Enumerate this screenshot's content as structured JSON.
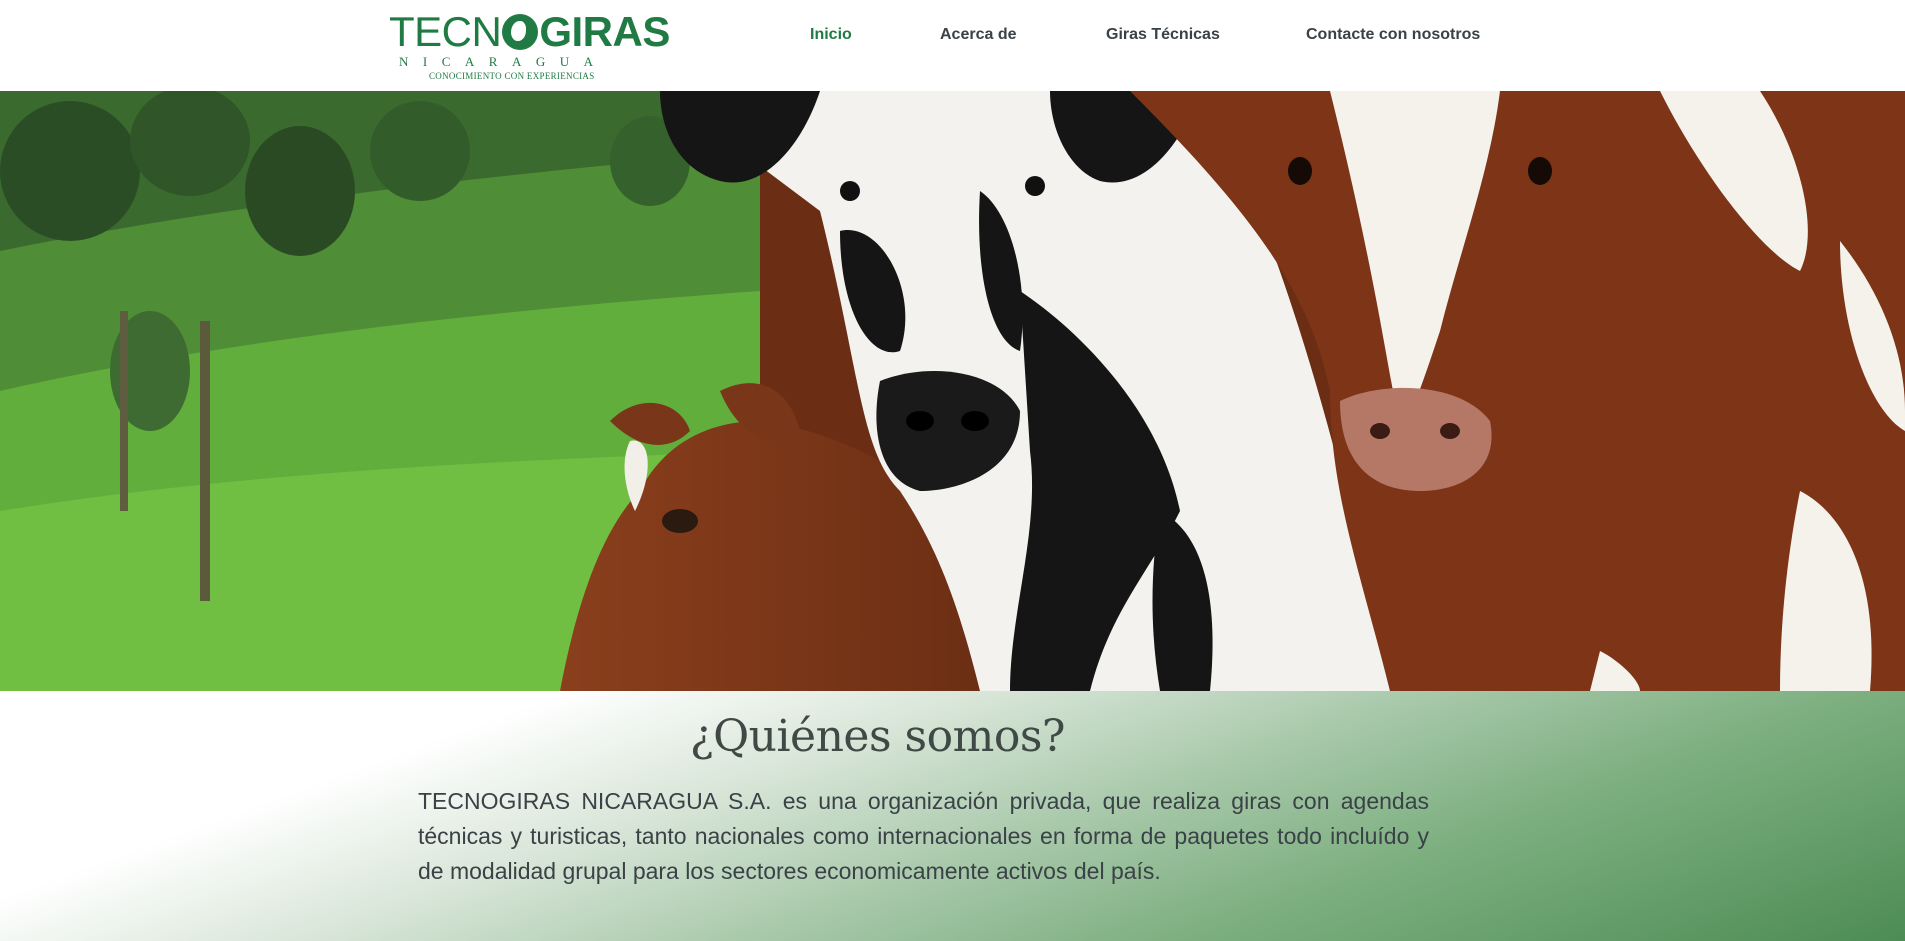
{
  "header": {
    "logo": {
      "word_left": "TECN",
      "word_right": "GIRAS",
      "subtitle": "NICARAGUA",
      "tagline": "CONOCIMIENTO CON EXPERIENCIAS"
    },
    "nav": {
      "items": [
        {
          "label": "Inicio",
          "active": true
        },
        {
          "label": "Acerca de",
          "active": false
        },
        {
          "label": "Giras Técnicas",
          "active": false
        },
        {
          "label": "Contacte con nosotros",
          "active": false
        }
      ]
    }
  },
  "hero": {
    "image": "cows-in-green-pasture-photo"
  },
  "about": {
    "title": "¿Quiénes somos?",
    "text": "TECNOGIRAS NICARAGUA S.A. es una organización privada, que realiza giras con agendas técnicas y turisticas, tanto nacionales como internacionales en forma de paquetes todo incluído y de modalidad grupal para los sectores economicamente activos del país."
  },
  "colors": {
    "brand_green": "#1f7a43",
    "text_dark": "#3a4147",
    "gradient_green": "#4d8c55"
  }
}
